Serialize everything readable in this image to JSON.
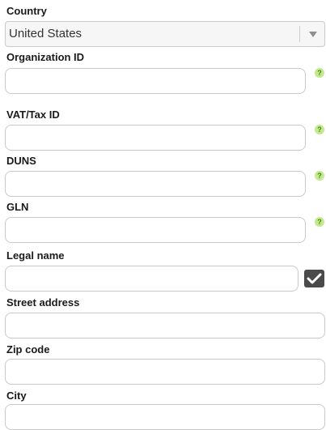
{
  "country": {
    "label": "Country",
    "value": "United States"
  },
  "organization_id": {
    "label": "Organization ID",
    "value": ""
  },
  "vat_tax_id": {
    "label": "VAT/Tax ID",
    "value": ""
  },
  "duns": {
    "label": "DUNS",
    "value": ""
  },
  "gln": {
    "label": "GLN",
    "value": ""
  },
  "legal_name": {
    "label": "Legal name",
    "value": "",
    "checkbox_checked": true
  },
  "street_address": {
    "label": "Street address",
    "value": ""
  },
  "zip_code": {
    "label": "Zip code",
    "value": ""
  },
  "city": {
    "label": "City",
    "value": ""
  },
  "help_glyph": "?",
  "icons": [
    "chevron-down-icon",
    "help-icon",
    "checkmark-icon"
  ],
  "colors": {
    "help_badge": "#c6e88f",
    "help_text": "#3b8a12",
    "checkbox_bg": "#4a4a4a"
  }
}
